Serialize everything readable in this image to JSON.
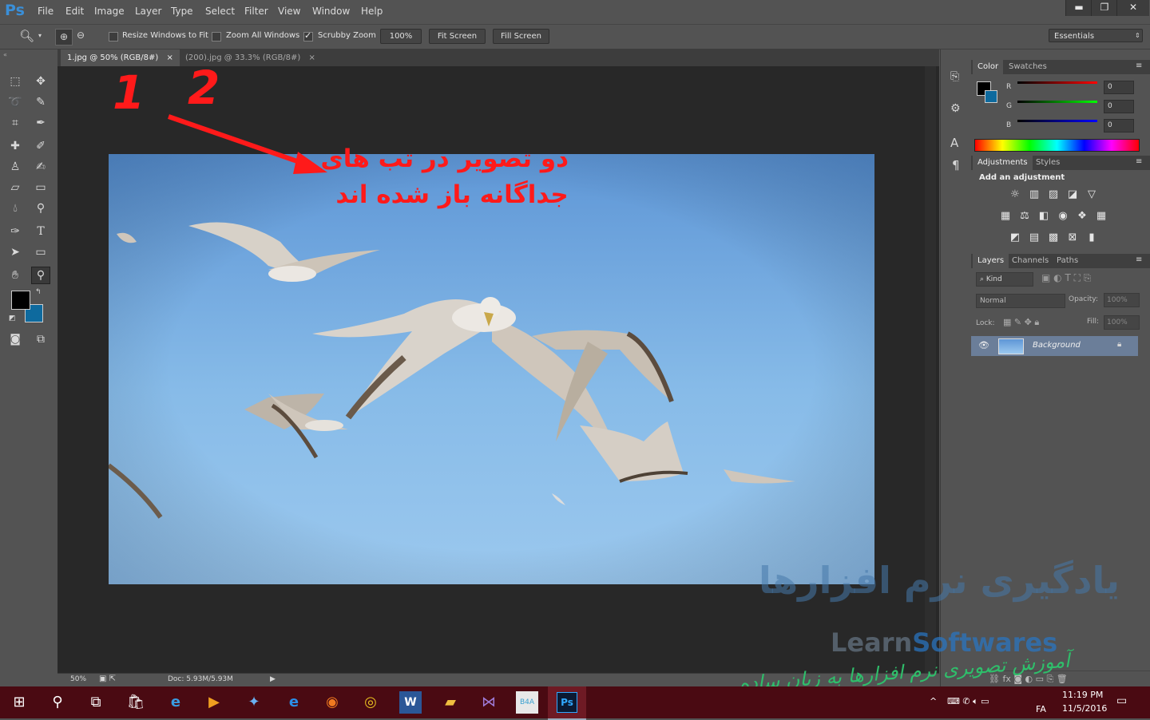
{
  "app": {
    "logo": "Ps"
  },
  "menu": [
    "File",
    "Edit",
    "Image",
    "Layer",
    "Type",
    "Select",
    "Filter",
    "View",
    "Window",
    "Help"
  ],
  "window_controls": {
    "minimize": "▬",
    "restore": "❐",
    "close": "✕"
  },
  "options": {
    "resize_windows": "Resize Windows to Fit",
    "zoom_all": "Zoom All Windows",
    "scrubby": "Scrubby Zoom",
    "btn_100": "100%",
    "fit_screen": "Fit Screen",
    "fill_screen": "Fill Screen",
    "workspace": "Essentials"
  },
  "tabs": [
    {
      "label": "1.jpg @ 50% (RGB/8#)",
      "close": "×",
      "active": true
    },
    {
      "label": "(200).jpg @ 33.3% (RGB/8#)",
      "close": "×",
      "active": false
    }
  ],
  "annotation": {
    "num1": "1",
    "num2": "2",
    "line1": "دو تصویر در تب های",
    "line2": "جداگانه باز شده اند"
  },
  "status": {
    "zoom": "50%",
    "doc": "Doc: 5.93M/5.93M"
  },
  "color_panel": {
    "tabs": [
      "Color",
      "Swatches"
    ],
    "channels": [
      {
        "name": "R",
        "value": "0"
      },
      {
        "name": "G",
        "value": "0"
      },
      {
        "name": "B",
        "value": "0"
      }
    ],
    "colors": {
      "foreground": "#000000",
      "background": "#0e6a9e"
    }
  },
  "adjustments_panel": {
    "tabs": [
      "Adjustments",
      "Styles"
    ],
    "heading": "Add an adjustment"
  },
  "layers_panel": {
    "tabs": [
      "Layers",
      "Channels",
      "Paths"
    ],
    "kind": "Kind",
    "blend": "Normal",
    "opacity_label": "Opacity:",
    "opacity": "100%",
    "lock_label": "Lock:",
    "fill_label": "Fill:",
    "fill": "100%",
    "layers": [
      {
        "name": "Background"
      }
    ]
  },
  "watermark": {
    "fa_title": "یادگیری نرم افزارها",
    "en_learn": "Learn",
    "en_soft": "Softwares",
    "fa_sub": "آموزش تصویری نرم افزارها به زبان ساده"
  },
  "taskbar": {
    "time": "11:19 PM",
    "date": "11/5/2016",
    "lang": "FA",
    "app_badge": "B4A",
    "ps": "Ps"
  }
}
